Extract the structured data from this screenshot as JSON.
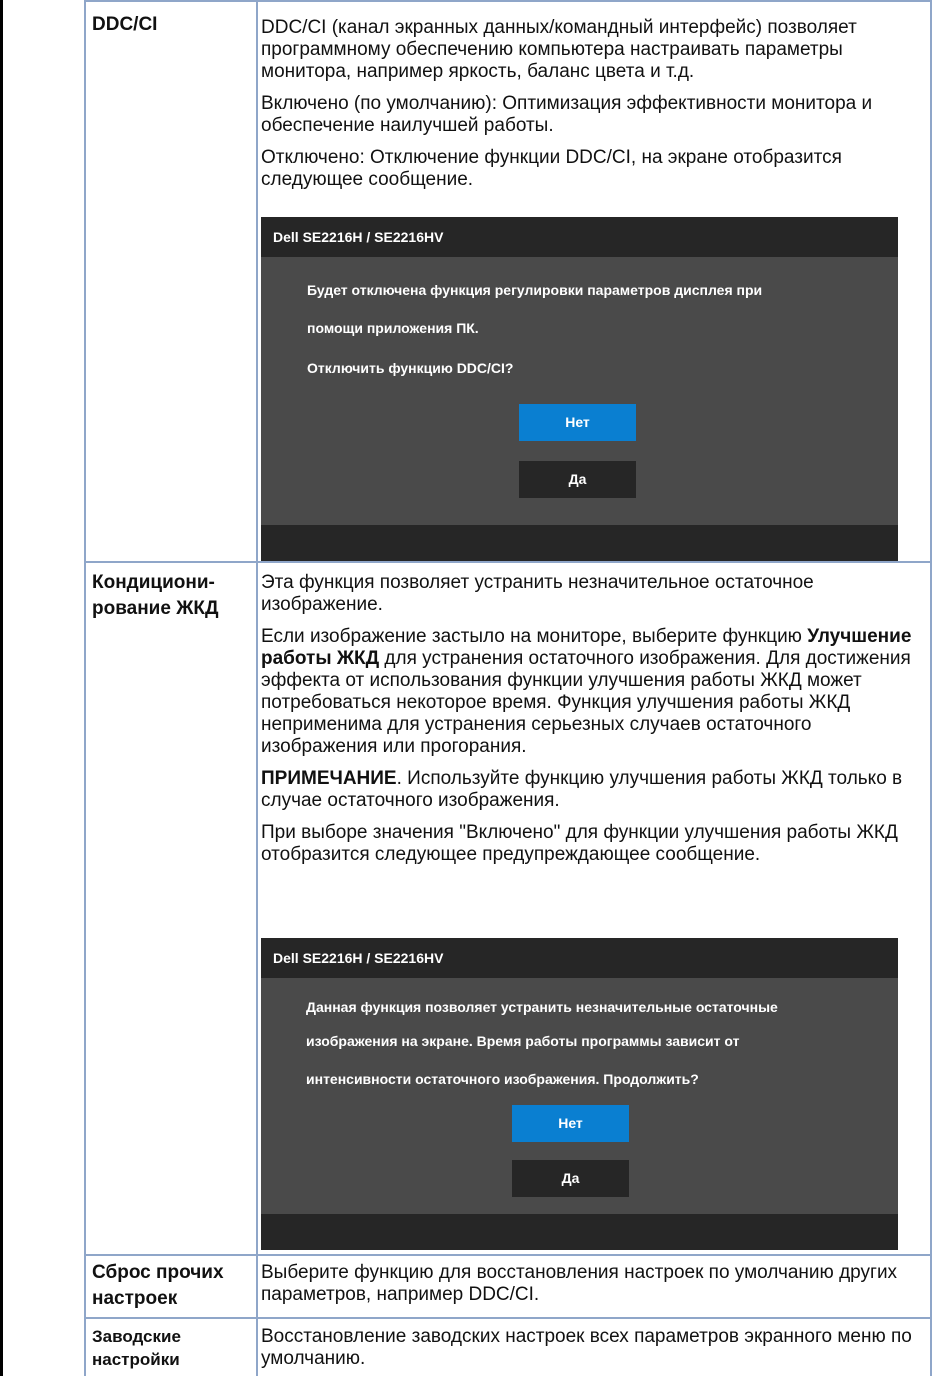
{
  "rows": [
    {
      "label": "DDC/CI",
      "paragraphs": [
        "DDC/CI (канал экранных данных/командный интерфейс) позволяет программному обеспечению компьютера настраивать параметры монитора, например яркость, баланс цвета и т.д.",
        "Включено (по умолчанию): Оптимизация эффективности монитора и обеспечение наилучшей работы.",
        "Отключено: Отключение функции DDC/CI, на экране отобразится следующее сообщение."
      ],
      "osd": {
        "title": "Dell SE2216H / SE2216HV",
        "lines": [
          "Будет отключена функция регулировки параметров дисплея при",
          "помощи приложения ПК.",
          "Отключить функцию DDC/CI?"
        ],
        "no_label": "Нет",
        "yes_label": "Да"
      }
    },
    {
      "label": "Кондициони-рование ЖКД",
      "paragraphs": [
        "Эта функция позволяет устранить незначительное остаточное изображение.",
        "Если изображение застыло на мониторе, выберите функцию Улучшение работы ЖКД для устранения остаточного изображения. Для достижения эффекта от использования функции улучшения работы ЖКД может потребоваться некоторое время. Функция улучшения работы ЖКД неприменима для устранения серьезных случаев остаточного изображения или прогорания.",
        "ПРИМЕЧАНИЕ. Используйте функцию улучшения работы ЖКД только в случае остаточного изображения.",
        "При выборе значения \"Включено\" для функции улучшения работы ЖКД отобразится следующее предупреждающее сообщение."
      ],
      "osd": {
        "title": "Dell SE2216H / SE2216HV",
        "lines": [
          "Данная функция позволяет устранить незначительные остаточные",
          "изображения на экране. Время работы программы зависит от",
          "интенсивности остаточного изображения. Продолжить?"
        ],
        "no_label": "Нет",
        "yes_label": "Да"
      }
    },
    {
      "label": "Сброс прочих настроек",
      "paragraphs": [
        "Выберите функцию для восстановления настроек по умолчанию других параметров, например DDC/CI."
      ]
    },
    {
      "label": "Заводские настройки",
      "paragraphs": [
        "Восстановление заводских настроек всех параметров экранного меню по умолчанию."
      ]
    }
  ],
  "row2_bold": {
    "p2_bold": "Улучшение работы ЖКД",
    "p2_rest": " для устранения остаточного изображения. Для достижения эффекта от использования функции улучшения работы ЖКД может потребоваться некоторое время. Функция улучшения работы ЖКД неприменима для устранения серьезных случаев остаточного изображения или прогорания.",
    "p2_pre": "Если изображение застыло на мониторе, выберите функцию ",
    "p3_bold": "ПРИМЕЧАНИЕ",
    "p3_rest": ". Используйте функцию улучшения работы ЖКД только в случае остаточного изображения."
  }
}
